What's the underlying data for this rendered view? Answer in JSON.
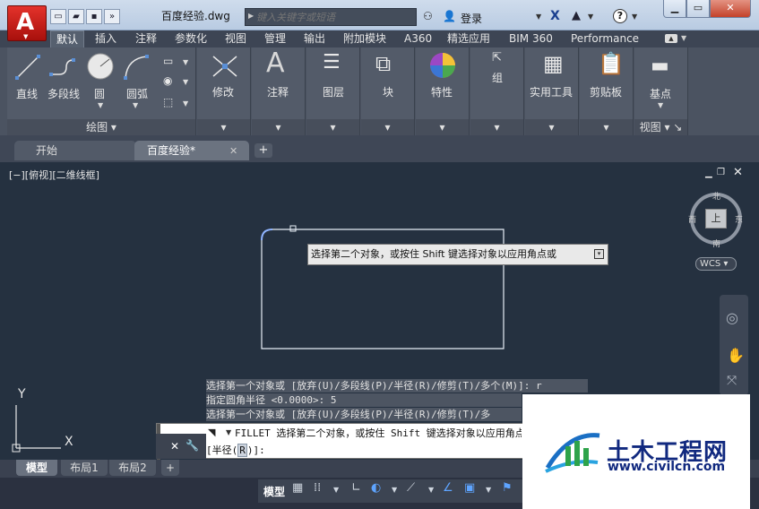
{
  "titlebar": {
    "doc_title": "百度经验.dwg",
    "search_placeholder": "键入关键字或短语",
    "login": "登录",
    "help": "?",
    "min": "▁",
    "max": "▭",
    "close": "✕",
    "app_letter": "A"
  },
  "ribbon_tabs": [
    "默认",
    "插入",
    "注释",
    "参数化",
    "视图",
    "管理",
    "输出",
    "附加模块",
    "A360",
    "精选应用",
    "BIM 360",
    "Performance"
  ],
  "ribbon": {
    "draw": {
      "line": "直线",
      "polyline": "多段线",
      "circle": "圆",
      "arc": "圆弧",
      "footer": "绘图"
    },
    "modify": "修改",
    "annotate": "注释",
    "layers": "图层",
    "block": "块",
    "properties": "特性",
    "groups": "组",
    "utilities": "实用工具",
    "clipboard": "剪贴板",
    "view": {
      "basepoint": "基点",
      "footer": "视图"
    }
  },
  "file_tabs": {
    "start": "开始",
    "doc": "百度经验*",
    "close": "✕",
    "add": "+"
  },
  "viewport": {
    "label": "[−][俯视][二维线框]"
  },
  "viewcube": {
    "north": "北",
    "south": "南",
    "east": "东",
    "west": "西",
    "top": "上",
    "wcs": "WCS"
  },
  "tooltip": "选择第二个对象，或按住 Shift 键选择对象以应用角点或",
  "ucs": {
    "y": "Y",
    "x": "X"
  },
  "command": {
    "history": [
      "选择第一个对象或 [放弃(U)/多段线(P)/半径(R)/修剪(T)/多个(M)]: r",
      "指定圆角半径 <0.0000>: 5",
      "选择第一个对象或 [放弃(U)/多段线(P)/半径(R)/修剪(T)/多"
    ],
    "current": "FILLET 选择第二个对象，或按住 Shift 键选择对象以应用角点或",
    "input_prefix": "[半径(",
    "input_option": "R",
    "input_suffix": ")]:"
  },
  "layout_tabs": [
    "模型",
    "布局1",
    "布局2",
    "+"
  ],
  "status": {
    "model": "模型"
  },
  "watermark": {
    "name": "土木工程网",
    "url": "www.civilcn.com"
  },
  "colors": {
    "canvas": "#253140",
    "ribbon": "#535b69",
    "accent_red": "#c8201b",
    "watermark_blue": "#11297f"
  }
}
